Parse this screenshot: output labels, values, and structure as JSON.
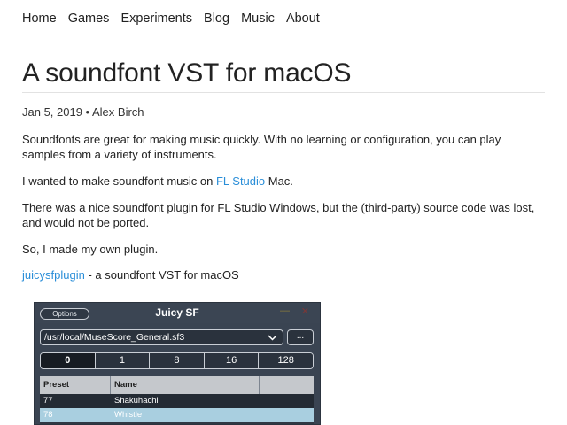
{
  "nav": [
    "Home",
    "Games",
    "Experiments",
    "Blog",
    "Music",
    "About"
  ],
  "post": {
    "title": "A soundfont VST for macOS",
    "meta": "Jan 5, 2019 • Alex Birch",
    "p1": "Soundfonts are great for making music quickly. With no learning or configuration, you can play samples from a variety of instruments.",
    "p2_before": "I wanted to make soundfont music on ",
    "p2_link": "FL Studio",
    "p2_after": " Mac.",
    "p3": "There was a nice soundfont plugin for FL Studio Windows, but the (third-party) source code was lost, and would not be ported.",
    "p4": "So, I made my own plugin.",
    "p5_link": "juicysfplugin",
    "p5_after": " - a soundfont VST for macOS"
  },
  "plugin": {
    "options_label": "Options",
    "title": "Juicy SF",
    "minimize_glyph": "—",
    "close_glyph": "✕",
    "path": "/usr/local/MuseScore_General.sf3",
    "chevron_icon": "chevron-down-icon",
    "browse_label": "...",
    "banks": [
      "0",
      "1",
      "8",
      "16",
      "128"
    ],
    "selected_bank": "0",
    "columns": [
      "Preset",
      "Name",
      ""
    ],
    "rows": [
      {
        "preset": "77",
        "name": "Shakuhachi"
      },
      {
        "preset": "78",
        "name": "Whistle"
      }
    ],
    "selected_row": "78",
    "colors": {
      "window_bg": "#3a4452",
      "link": "#2a8ed8",
      "selected_row": "#a9cfe0"
    }
  }
}
